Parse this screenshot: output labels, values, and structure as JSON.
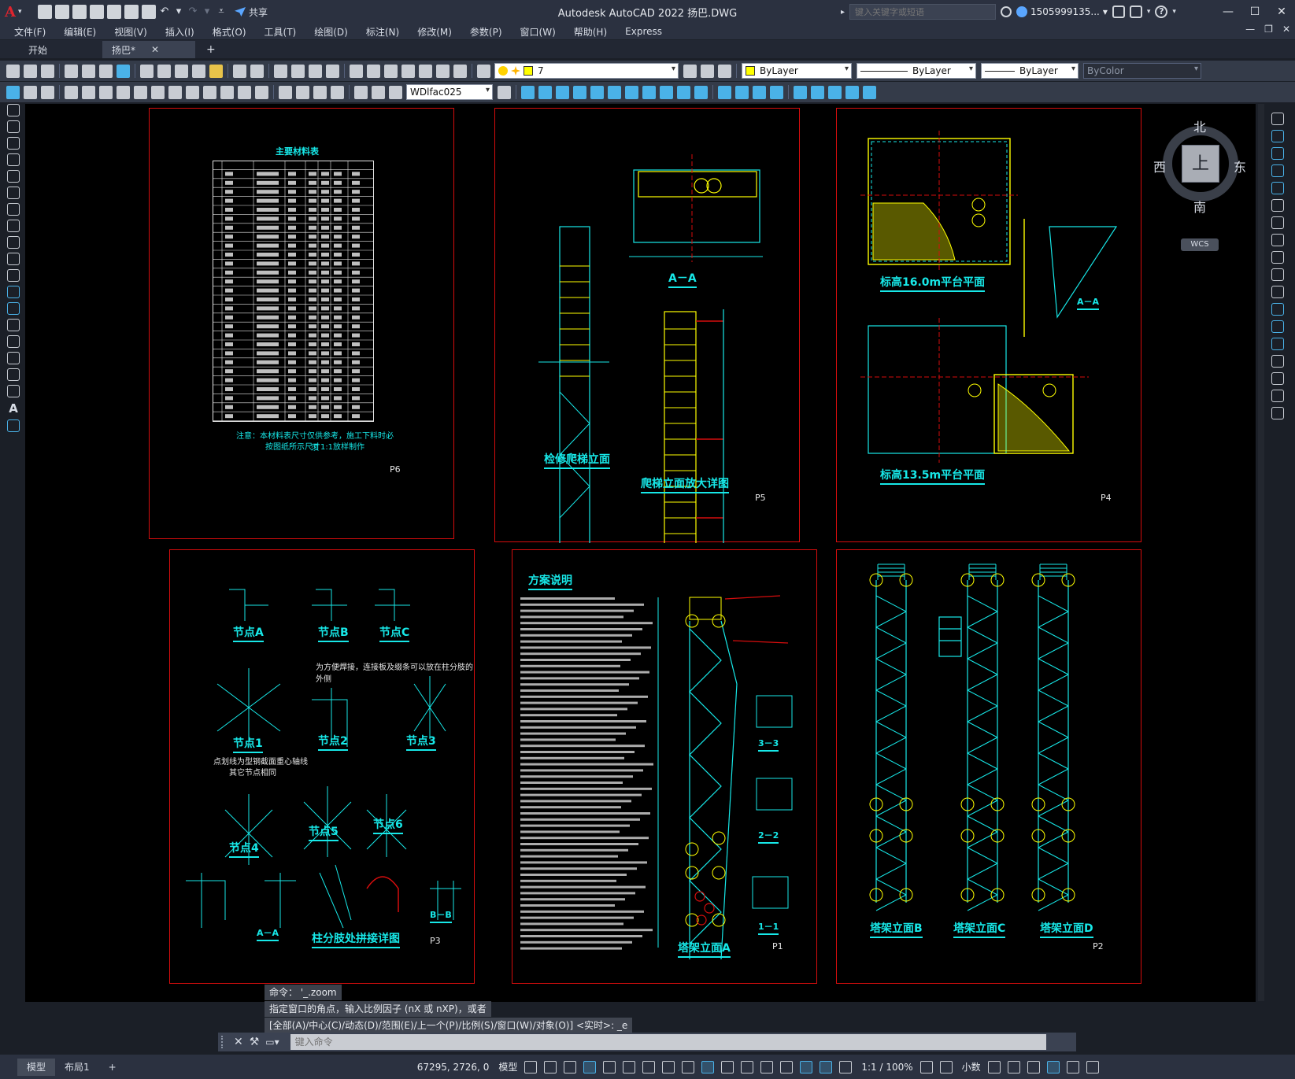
{
  "app": {
    "logo_letter": "A",
    "title": "Autodesk AutoCAD 2022    扬巴.DWG",
    "search_placeholder": "键入关键字或短语",
    "user": "1505999135...",
    "share_label": "共享"
  },
  "menu": [
    "文件(F)",
    "编辑(E)",
    "视图(V)",
    "插入(I)",
    "格式(O)",
    "工具(T)",
    "绘图(D)",
    "标注(N)",
    "修改(M)",
    "参数(P)",
    "窗口(W)",
    "帮助(H)",
    "Express"
  ],
  "tabs": {
    "start": "开始",
    "active": "扬巴*",
    "plus": "+"
  },
  "properties": {
    "layer": "7",
    "color": "ByLayer",
    "linetype": "ByLayer",
    "lineweight": "ByLayer",
    "plotstyle": "ByColor",
    "dimstyle": "WDlfac025"
  },
  "viewcube": {
    "face": "上",
    "north": "北",
    "south": "南",
    "east": "东",
    "west": "西",
    "wcs": "WCS"
  },
  "sheets": {
    "p6": {
      "label": "P6",
      "table_title": "主要材料表",
      "note1": "注意：本材料表尺寸仅供参考，施工下料时必须",
      "note2": "按图纸所示尺寸1:1放样制作"
    },
    "p5": {
      "label": "P5",
      "title1": "A－A",
      "title2": "检修爬梯立面",
      "title3": "爬梯立面放大详图"
    },
    "p4": {
      "label": "P4",
      "title1": "标高16.0m平台平面",
      "title2": "标高13.5m平台平面",
      "title3": "A－A"
    },
    "p3": {
      "label": "P3",
      "node_a": "节点A",
      "node_b": "节点B",
      "node_c": "节点C",
      "node_1": "节点1",
      "node_2": "节点2",
      "node_3": "节点3",
      "node_4": "节点4",
      "node_5": "节点5",
      "node_6": "节点6",
      "note1": "为方便焊接，连接板及缀条可以放在柱分肢的外侧",
      "note2": "点划线为型钢截面重心轴线",
      "note3": "其它节点相同",
      "splice": "柱分肢处拼接详图",
      "aa": "A－A",
      "bb": "B－B"
    },
    "p1": {
      "label": "P1",
      "title": "方案说明",
      "elev_a": "塔架立面A",
      "s33": "3－3",
      "s22": "2－2",
      "s11": "1－1"
    },
    "p2": {
      "label": "P2",
      "elev_b": "塔架立面B",
      "elev_c": "塔架立面C",
      "elev_d": "塔架立面D"
    }
  },
  "command": {
    "history": [
      "命令： '_.zoom",
      "指定窗口的角点，输入比例因子 (nX 或 nXP)，或者",
      "[全部(A)/中心(C)/动态(D)/范围(E)/上一个(P)/比例(S)/窗口(W)/对象(O)] <实时>: _e"
    ],
    "placeholder": "键入命令"
  },
  "status": {
    "model_tab": "模型",
    "layout_tab": "布局1",
    "plus": "+",
    "coords": "67295, 2726, 0",
    "space": "模型",
    "scale": "1:1 / 100%",
    "units": "小数"
  }
}
